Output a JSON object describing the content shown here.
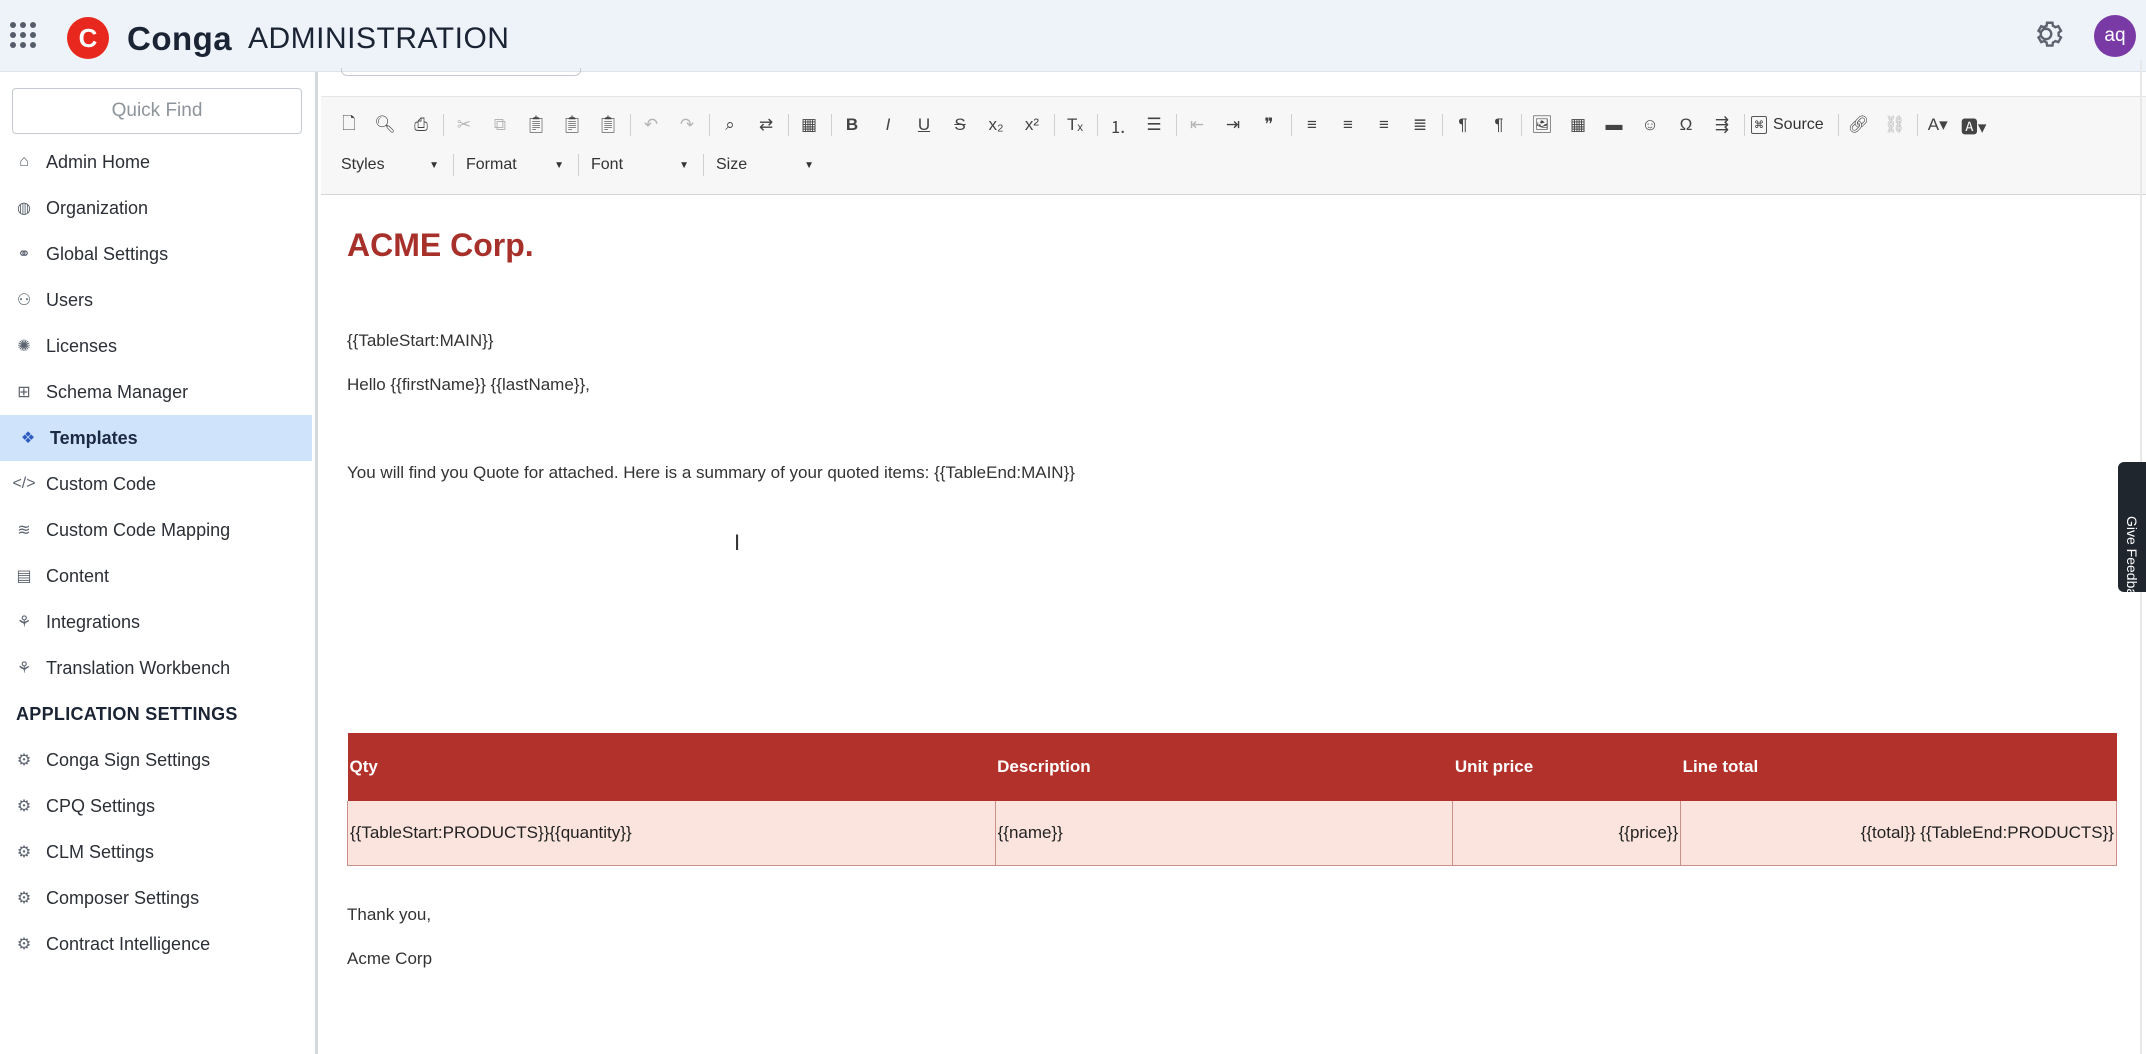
{
  "header": {
    "brand": "Conga",
    "section": "ADMINISTRATION",
    "avatar_initials": "aq"
  },
  "sidebar": {
    "quickfind_placeholder": "Quick Find",
    "items": [
      {
        "label": "Admin Home",
        "icon": "home-icon"
      },
      {
        "label": "Organization",
        "icon": "globe-icon"
      },
      {
        "label": "Global Settings",
        "icon": "link-icon"
      },
      {
        "label": "Users",
        "icon": "users-icon"
      },
      {
        "label": "Licenses",
        "icon": "badge-icon"
      },
      {
        "label": "Schema Manager",
        "icon": "schema-icon"
      },
      {
        "label": "Templates",
        "icon": "templates-icon",
        "active": true
      },
      {
        "label": "Custom Code",
        "icon": "code-icon"
      },
      {
        "label": "Custom Code Mapping",
        "icon": "layers-icon"
      },
      {
        "label": "Content",
        "icon": "content-icon"
      },
      {
        "label": "Integrations",
        "icon": "integrations-icon"
      },
      {
        "label": "Translation Workbench",
        "icon": "translate-icon"
      }
    ],
    "app_settings_heading": "APPLICATION SETTINGS",
    "app_settings": [
      {
        "label": "Conga Sign Settings"
      },
      {
        "label": "CPQ Settings"
      },
      {
        "label": "CLM Settings"
      },
      {
        "label": "Composer Settings"
      },
      {
        "label": "Contract Intelligence"
      }
    ]
  },
  "toolbar": {
    "source_label": "Source",
    "combos": {
      "styles": "Styles",
      "format": "Format",
      "font": "Font",
      "size": "Size"
    }
  },
  "document": {
    "title": "ACME Corp.",
    "table_start_main": "{{TableStart:MAIN}}",
    "greeting": "Hello {{firstName}} {{lastName}},",
    "summary_line": "You will find you Quote for  attached. Here is a summary of your quoted items: {{TableEnd:MAIN}}",
    "table": {
      "headers": [
        "Qty",
        "Description",
        "Unit price",
        "Line total"
      ],
      "row": [
        "{{TableStart:PRODUCTS}}{{quantity}}",
        "{{name}}",
        "{{price}}",
        "{{total}} {{TableEnd:PRODUCTS}}"
      ]
    },
    "closing": "Thank you,",
    "signature": "Acme Corp"
  },
  "feedback_tab": "Give Feedback",
  "colors": {
    "accent": "#a8302b",
    "table_header": "#b3312b",
    "table_row": "#fbe4dd",
    "active_nav": "#cfe3fb",
    "logo": "#e8281e",
    "avatar": "#7a3aa6"
  }
}
